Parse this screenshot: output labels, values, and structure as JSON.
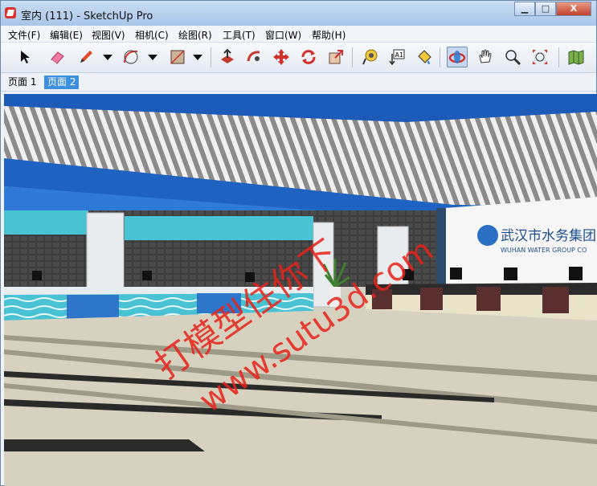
{
  "window": {
    "title": "室内 (111) - SketchUp Pro"
  },
  "window_controls": {
    "minimize": "▁",
    "maximize": "□",
    "close": "X"
  },
  "menu": [
    "文件(F)",
    "编辑(E)",
    "视图(V)",
    "相机(C)",
    "绘图(R)",
    "工具(T)",
    "窗口(W)",
    "帮助(H)"
  ],
  "toolbar": [
    {
      "name": "select-icon"
    },
    {
      "name": "eraser-icon"
    },
    {
      "name": "pencil-icon"
    },
    {
      "name": "arc-icon"
    },
    {
      "name": "rectangle-icon"
    },
    {
      "name": "push-pull-icon"
    },
    {
      "name": "follow-me-icon"
    },
    {
      "name": "move-icon"
    },
    {
      "name": "rotate-icon"
    },
    {
      "name": "scale-icon"
    },
    {
      "name": "tape-measure-icon"
    },
    {
      "name": "text-icon"
    },
    {
      "name": "paint-bucket-icon"
    },
    {
      "name": "orbit-icon"
    },
    {
      "name": "pan-icon"
    },
    {
      "name": "zoom-icon"
    },
    {
      "name": "zoom-extents-icon"
    },
    {
      "name": "map-icon"
    }
  ],
  "scenes": {
    "tabs": [
      "页面 1",
      "页面 2"
    ],
    "active": 1
  },
  "viewport": {
    "sign_text": "武汉市水务集团",
    "sign_subtext": "WUHAN WATER GROUP CO",
    "watermark_cn": "打模型住你下",
    "watermark_url": "www.sutu3d.com"
  },
  "colors": {
    "ceiling_blue": "#1f63c2",
    "ceiling_stripe": "#8b8b8b",
    "floor": "#d7d2bf",
    "floor_stripe": "#2a2a2a",
    "counter_cyan": "#49c3d4",
    "watermark": "#e8231a"
  }
}
